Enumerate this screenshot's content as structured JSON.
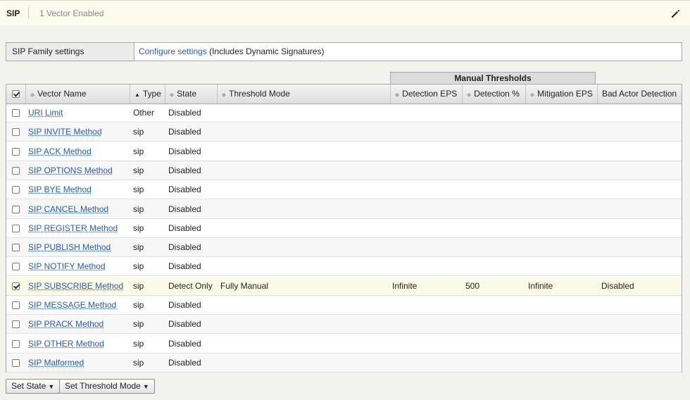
{
  "header": {
    "title": "SIP",
    "subtitle": "1 Vector Enabled",
    "edit_icon": "pencil-icon"
  },
  "family": {
    "label": "SIP Family settings",
    "link": "Configure settings",
    "note": "(Includes Dynamic Signatures)"
  },
  "table": {
    "group_header": "Manual Thresholds",
    "columns": {
      "vector_name": "Vector Name",
      "type": "Type",
      "state": "State",
      "threshold_mode": "Threshold Mode",
      "detection_eps": "Detection EPS",
      "detection_pct": "Detection %",
      "mitigation_eps": "Mitigation EPS",
      "bad_actor": "Bad Actor Detection"
    },
    "rows": [
      {
        "name": "URI Limit",
        "type": "Other",
        "state": "Disabled",
        "mode": "",
        "det_eps": "",
        "det_pct": "",
        "mit_eps": "",
        "bad_actor": "",
        "checked": false
      },
      {
        "name": "SIP INVITE Method",
        "type": "sip",
        "state": "Disabled",
        "mode": "",
        "det_eps": "",
        "det_pct": "",
        "mit_eps": "",
        "bad_actor": "",
        "checked": false
      },
      {
        "name": "SIP ACK Method",
        "type": "sip",
        "state": "Disabled",
        "mode": "",
        "det_eps": "",
        "det_pct": "",
        "mit_eps": "",
        "bad_actor": "",
        "checked": false
      },
      {
        "name": "SIP OPTIONS Method",
        "type": "sip",
        "state": "Disabled",
        "mode": "",
        "det_eps": "",
        "det_pct": "",
        "mit_eps": "",
        "bad_actor": "",
        "checked": false
      },
      {
        "name": "SIP BYE Method",
        "type": "sip",
        "state": "Disabled",
        "mode": "",
        "det_eps": "",
        "det_pct": "",
        "mit_eps": "",
        "bad_actor": "",
        "checked": false
      },
      {
        "name": "SIP CANCEL Method",
        "type": "sip",
        "state": "Disabled",
        "mode": "",
        "det_eps": "",
        "det_pct": "",
        "mit_eps": "",
        "bad_actor": "",
        "checked": false
      },
      {
        "name": "SIP REGISTER Method",
        "type": "sip",
        "state": "Disabled",
        "mode": "",
        "det_eps": "",
        "det_pct": "",
        "mit_eps": "",
        "bad_actor": "",
        "checked": false
      },
      {
        "name": "SIP PUBLISH Method",
        "type": "sip",
        "state": "Disabled",
        "mode": "",
        "det_eps": "",
        "det_pct": "",
        "mit_eps": "",
        "bad_actor": "",
        "checked": false
      },
      {
        "name": "SIP NOTIFY Method",
        "type": "sip",
        "state": "Disabled",
        "mode": "",
        "det_eps": "",
        "det_pct": "",
        "mit_eps": "",
        "bad_actor": "",
        "checked": false
      },
      {
        "name": "SIP SUBSCRIBE Method",
        "type": "sip",
        "state": "Detect Only",
        "mode": "Fully Manual",
        "det_eps": "Infinite",
        "det_pct": "500",
        "mit_eps": "Infinite",
        "bad_actor": "Disabled",
        "checked": true
      },
      {
        "name": "SIP MESSAGE Method",
        "type": "sip",
        "state": "Disabled",
        "mode": "",
        "det_eps": "",
        "det_pct": "",
        "mit_eps": "",
        "bad_actor": "",
        "checked": false
      },
      {
        "name": "SIP PRACK Method",
        "type": "sip",
        "state": "Disabled",
        "mode": "",
        "det_eps": "",
        "det_pct": "",
        "mit_eps": "",
        "bad_actor": "",
        "checked": false
      },
      {
        "name": "SIP OTHER Method",
        "type": "sip",
        "state": "Disabled",
        "mode": "",
        "det_eps": "",
        "det_pct": "",
        "mit_eps": "",
        "bad_actor": "",
        "checked": false
      },
      {
        "name": "SIP Malformed",
        "type": "sip",
        "state": "Disabled",
        "mode": "",
        "det_eps": "",
        "det_pct": "",
        "mit_eps": "",
        "bad_actor": "",
        "checked": false
      }
    ]
  },
  "footer": {
    "set_state": "Set State",
    "set_threshold_mode": "Set Threshold Mode"
  },
  "colors": {
    "link": "#2a5ab3",
    "selected_row": "#fbfbe8",
    "topbar": "#fbfbee"
  }
}
